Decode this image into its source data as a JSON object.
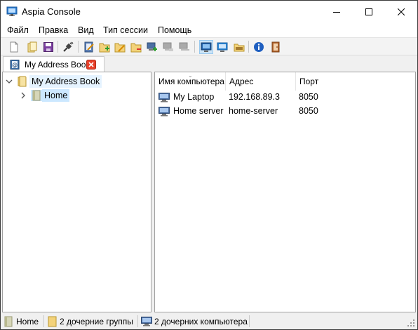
{
  "window": {
    "title": "Aspia Console"
  },
  "menu": [
    "Файл",
    "Правка",
    "Вид",
    "Тип сессии",
    "Помощь"
  ],
  "toolbar": {
    "icons": [
      "new-file-icon",
      "open-icon",
      "save-icon",
      "connect-plug-icon",
      "edit-book-icon",
      "add-group-icon",
      "edit-group-icon",
      "delete-group-icon",
      "add-computer-icon",
      "edit-computer-icon",
      "delete-computer-icon",
      "desktop-manage-icon",
      "desktop-view-icon",
      "file-transfer-icon",
      "about-icon",
      "exit-icon"
    ]
  },
  "tab": {
    "label": "My Address Book"
  },
  "tree": {
    "root": "My Address Book",
    "child": "Home"
  },
  "list": {
    "columns": [
      "Имя компьютера",
      "Адрес",
      "Порт"
    ],
    "rows": [
      {
        "name": "My Laptop",
        "address": "192.168.89.3",
        "port": "8050"
      },
      {
        "name": "Home server",
        "address": "home-server",
        "port": "8050"
      }
    ]
  },
  "status": {
    "group": "Home",
    "child_groups": "2 дочерние группы",
    "child_computers": "2 дочерних компьютера"
  },
  "colors": {
    "selection": "#cce8ff",
    "active_tool": "#cce4f7",
    "close_red": "#e81123"
  }
}
